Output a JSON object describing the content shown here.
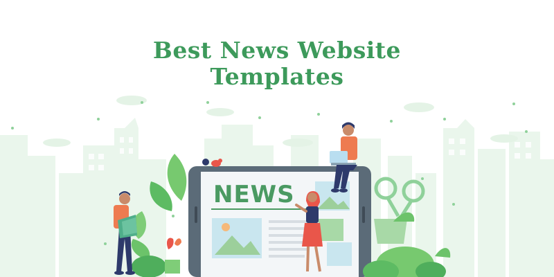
{
  "title": {
    "line1": "Best News Website",
    "line2": "Templates"
  },
  "tablet": {
    "headline": "NEWS"
  },
  "colors": {
    "title_green": "#3d9a5b",
    "headline_green": "#4a9a62",
    "skyline": "#e8f5ea",
    "tablet_frame": "#5b6b78",
    "screen_bg": "#f3f6f8",
    "leaf_green": "#6cc36a",
    "person_orange": "#ee7b50",
    "person_red": "#e9564a",
    "person_navy": "#2e3a6b"
  },
  "icons": [
    "bird-icon",
    "image-placeholder-icon",
    "paper-icon",
    "laptop-icon",
    "scissors-icon"
  ]
}
